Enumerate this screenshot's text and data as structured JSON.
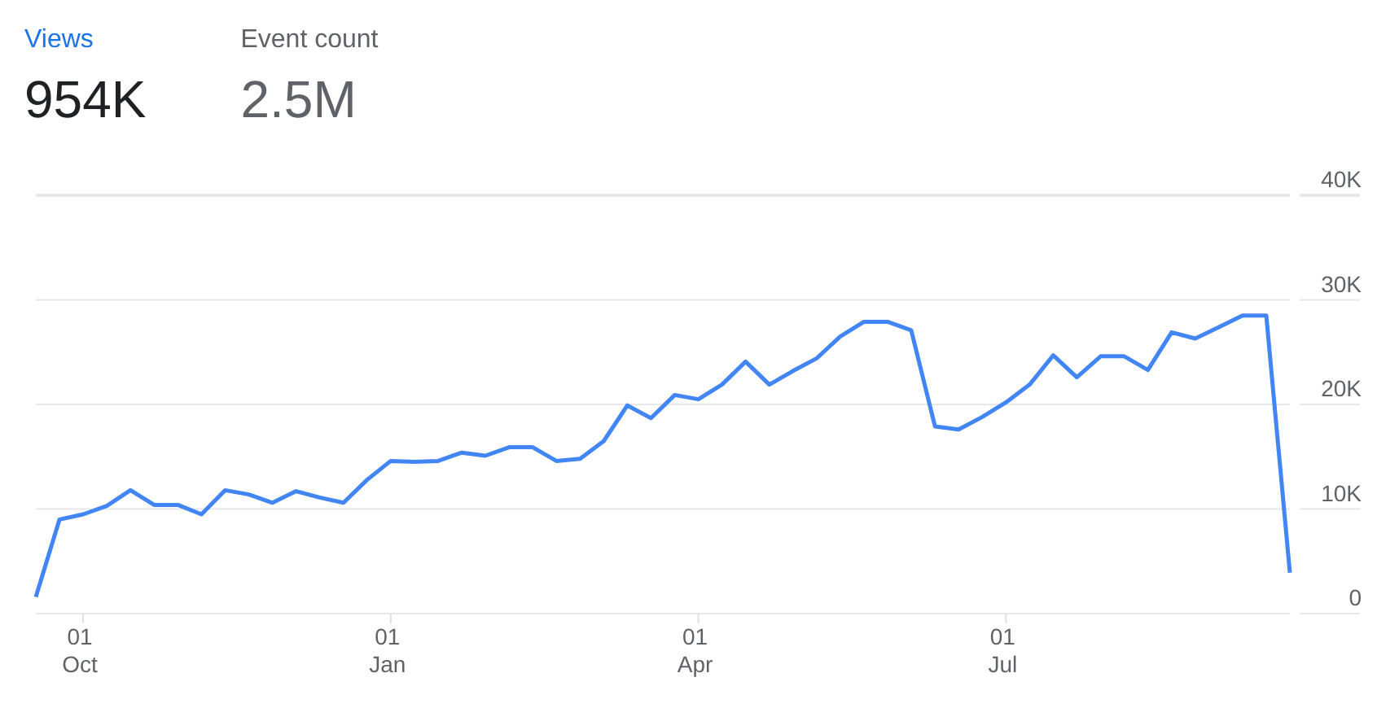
{
  "metrics": [
    {
      "label": "Views",
      "value": "954K",
      "selected": true
    },
    {
      "label": "Event count",
      "value": "2.5M",
      "selected": false
    }
  ],
  "chart_data": {
    "type": "line",
    "categories": [
      null,
      null,
      "01 Oct",
      null,
      null,
      null,
      null,
      null,
      null,
      null,
      null,
      null,
      null,
      null,
      null,
      "01 Jan",
      null,
      null,
      null,
      null,
      null,
      null,
      null,
      null,
      null,
      null,
      null,
      null,
      "01 Apr",
      null,
      null,
      null,
      null,
      null,
      null,
      null,
      null,
      null,
      null,
      null,
      null,
      "01 Jul",
      null,
      null,
      null,
      null,
      null,
      null,
      null,
      null,
      null,
      null,
      null,
      null
    ],
    "series": [
      {
        "color": "#4285f4",
        "values": [
          1600,
          9000,
          9500,
          10300,
          11800,
          10400,
          10400,
          9500,
          11800,
          11400,
          10600,
          11700,
          11100,
          10600,
          12800,
          14600,
          14500,
          14600,
          15400,
          15100,
          15900,
          15900,
          14600,
          14800,
          16500,
          19900,
          18700,
          20900,
          20500,
          21900,
          24100,
          21900,
          23200,
          24400,
          26500,
          27900,
          27900,
          27100,
          17900,
          17600,
          18800,
          20200,
          21900,
          24700,
          22600,
          24600,
          24600,
          23300,
          26900,
          26300,
          27400,
          28500,
          28500,
          3900
        ]
      }
    ],
    "ylim": [
      0,
      40000
    ],
    "grid": true,
    "yticks": [
      {
        "value": 0,
        "label": "0"
      },
      {
        "value": 10000,
        "label": "10K"
      },
      {
        "value": 20000,
        "label": "20K"
      },
      {
        "value": 30000,
        "label": "30K"
      },
      {
        "value": 40000,
        "label": "40K"
      }
    ]
  }
}
